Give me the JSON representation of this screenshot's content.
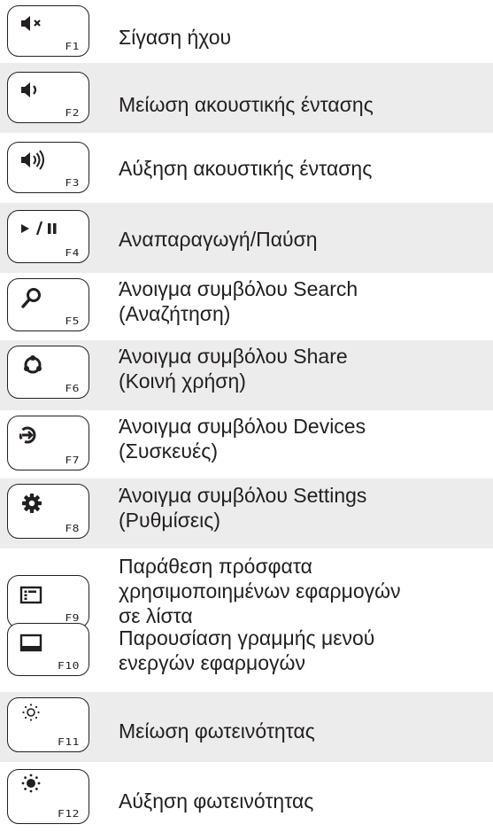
{
  "colors": {
    "text": "#231f20",
    "row_shade": "#ececec",
    "key_border": "#231f20"
  },
  "rows": [
    {
      "key": "F1",
      "icon": "mute-speaker-icon",
      "description": "Σίγαση ήχου"
    },
    {
      "key": "F2",
      "icon": "volume-down-icon",
      "description": "Μείωση ακουστικής έντασης"
    },
    {
      "key": "F3",
      "icon": "volume-up-icon",
      "description": "Αύξηση ακουστικής έντασης"
    },
    {
      "key": "F4",
      "icon": "play-pause-icon",
      "description": "Αναπαραγωγή/Παύση"
    },
    {
      "key": "F5",
      "icon": "search-icon",
      "description": "Άνοιγμα συμβόλου Search\n(Αναζήτηση)"
    },
    {
      "key": "F6",
      "icon": "share-icon",
      "description": "Άνοιγμα συμβόλου Share\n(Κοινή χρήση)"
    },
    {
      "key": "F7",
      "icon": "devices-icon",
      "description": "Άνοιγμα συμβόλου Devices\n(Συσκευές)"
    },
    {
      "key": "F8",
      "icon": "settings-gear-icon",
      "description": "Άνοιγμα συμβόλου Settings\n(Ρυθμίσεις)"
    },
    {
      "key": "F9",
      "icon": "recent-apps-list-icon",
      "description": "Παράθεση πρόσφατα\nχρησιμοποιημένων εφαρμογών\nσε λίστα"
    },
    {
      "key": "F10",
      "icon": "app-bar-icon",
      "description": "Παρουσίαση γραμμής μενού\nενεργών εφαρμογών"
    },
    {
      "key": "F11",
      "icon": "brightness-down-icon",
      "description": "Μείωση φωτεινότητας"
    },
    {
      "key": "F12",
      "icon": "brightness-up-icon",
      "description": "Αύξηση φωτεινότητας"
    }
  ]
}
